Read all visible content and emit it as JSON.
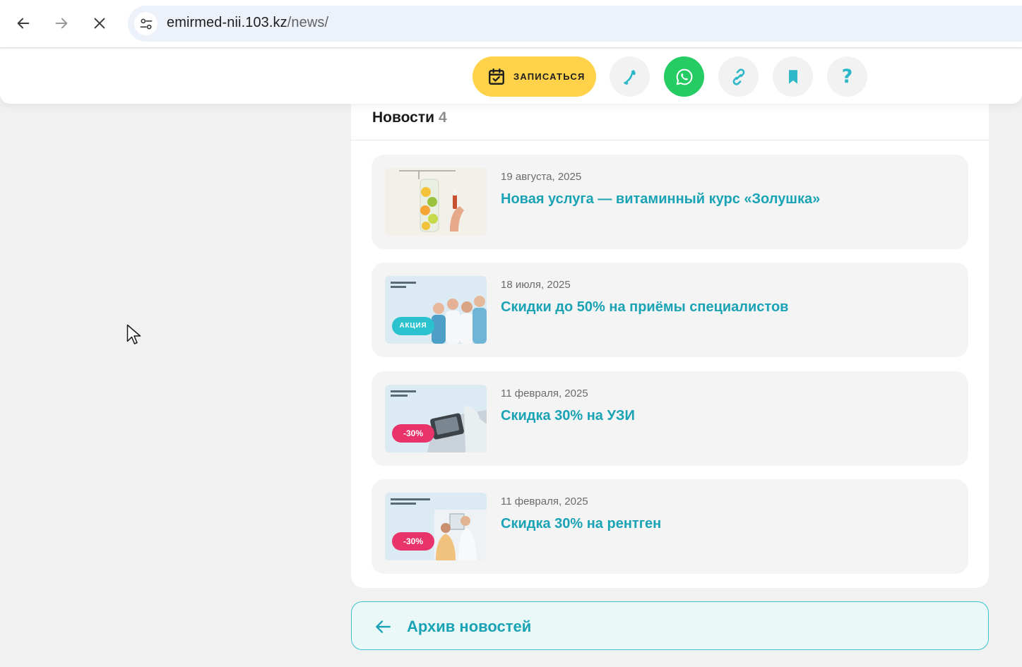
{
  "browser": {
    "url_host": "emirmed-nii.103.kz",
    "url_path": "/news/"
  },
  "header": {
    "book_label": "ЗАПИСАТЬСЯ",
    "help_glyph": "?"
  },
  "news": {
    "title": "Новости",
    "count": "4",
    "items": [
      {
        "date": "19 августа, 2025",
        "title": "Новая услуга — витаминный курс «Золушка»"
      },
      {
        "date": "18 июля, 2025",
        "title": "Скидки до 50% на приёмы специалистов",
        "badge": "АКЦИЯ"
      },
      {
        "date": "11 февраля, 2025",
        "title": "Скидка 30% на УЗИ",
        "badge": "-30%"
      },
      {
        "date": "11 февраля, 2025",
        "title": "Скидка 30% на рентген",
        "badge": "-30%"
      }
    ]
  },
  "archive": {
    "label": "Архив новостей"
  },
  "colors": {
    "accent": "#1aa3b5",
    "book_button": "#ffd24a",
    "whatsapp": "#24cc63",
    "badge_teal": "#2cc1cf",
    "badge_pink": "#e8336b"
  },
  "icons": {
    "back": "arrow-left-icon",
    "forward": "arrow-right-icon",
    "stop": "close-icon",
    "site_info": "tune-icon",
    "book": "calendar-check-icon",
    "phone": "phone-icon",
    "whatsapp": "whatsapp-icon",
    "link": "link-icon",
    "bookmark": "bookmark-icon",
    "archive": "arrow-left-icon"
  }
}
